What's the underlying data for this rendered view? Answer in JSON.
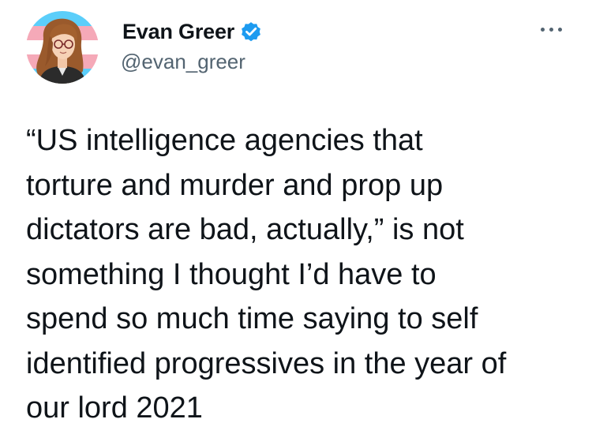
{
  "tweet": {
    "author": {
      "display_name": "Evan Greer",
      "handle": "@evan_greer",
      "verified": true,
      "avatar_icon": "profile-photo-trans-flag-background"
    },
    "more_menu_icon": "more-horizontal-icon",
    "text": "“US intelligence agencies that\ntorture and murder and prop up\ndictators are bad, actually,” is not\nsomething I thought I’d have to\nspend so much time saying to self\nidentified progressives in the year of\nour lord 2021"
  },
  "colors": {
    "text": "#0f1419",
    "secondary": "#536471",
    "verified_blue": "#1d9bf0",
    "flag_blue": "#5bcefa",
    "flag_pink": "#f5a9b8",
    "flag_white": "#ffffff"
  }
}
